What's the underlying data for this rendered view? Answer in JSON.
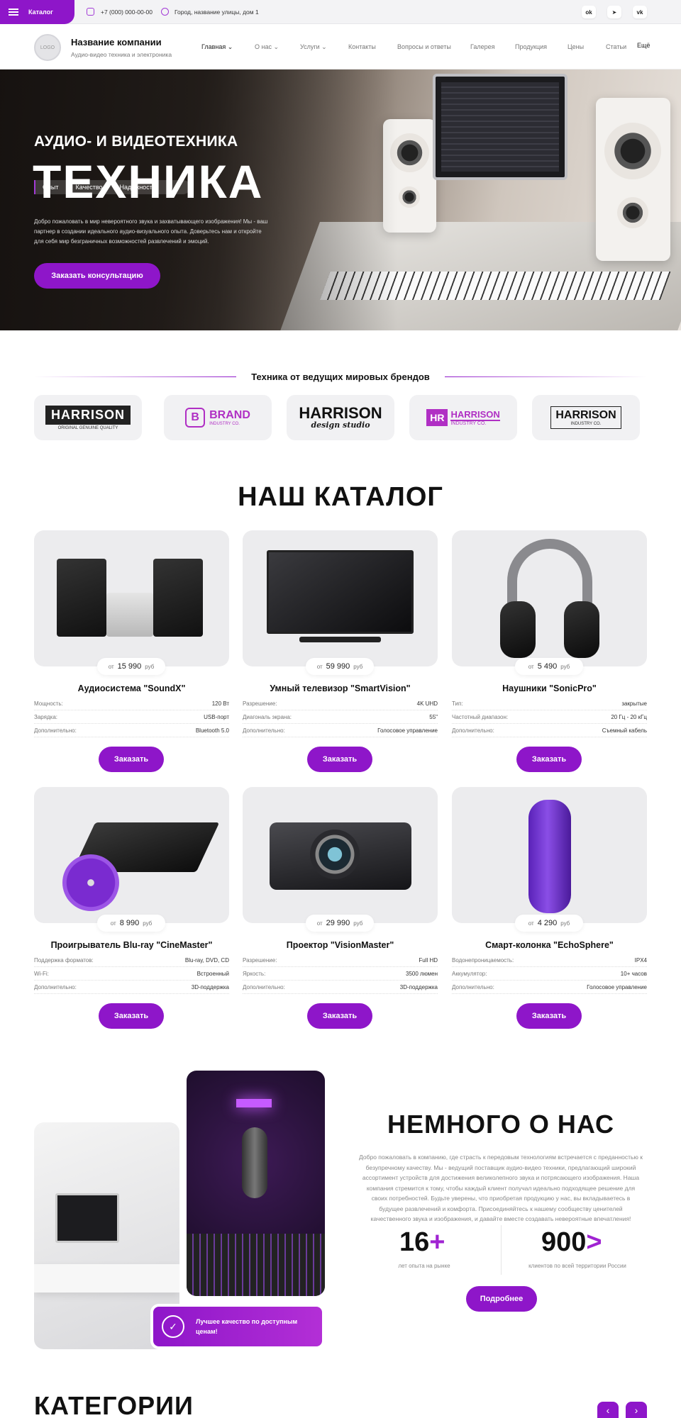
{
  "topbar": {
    "catalog_label": "Каталог",
    "phone": "+7 (000) 000-00-00",
    "address": "Город, название улицы, дом 1",
    "socials": [
      {
        "icon": "ok-icon",
        "label": "ok"
      },
      {
        "icon": "telegram-icon",
        "label": "➤"
      },
      {
        "icon": "vk-icon",
        "label": "vk"
      }
    ]
  },
  "header": {
    "logo_text": "LOGO",
    "company_name": "Название компании",
    "tagline": "Аудио-видео техника и электроника",
    "nav": [
      {
        "label": "Главная ⌄",
        "active": true
      },
      {
        "label": "О нас ⌄",
        "active": false
      },
      {
        "label": "Услуги ⌄",
        "active": false
      },
      {
        "label": "Контакты",
        "active": false
      },
      {
        "label": "Вопросы и ответы",
        "active": false
      },
      {
        "label": "Галерея",
        "active": false
      },
      {
        "label": "Продукция",
        "active": false
      },
      {
        "label": "Цены",
        "active": false
      },
      {
        "label": "Статьи",
        "active": false
      },
      {
        "label": "Ещё",
        "active": true
      }
    ]
  },
  "hero": {
    "badges": [
      "Опыт",
      "Качество",
      "Надежность"
    ],
    "subtitle": "АУДИО- И ВИДЕОТЕХНИКА",
    "title": "ТЕХНИКА",
    "description": "Добро пожаловать в мир невероятного звука и захватывающего изображения! Мы - ваш партнер в создании идеального аудио-визуального опыта. Доверьтесь нам и откройте для себя мир безграничных возможностей развлечений и эмоций.",
    "cta_label": "Заказать консультацию"
  },
  "brands": {
    "title": "Техника от ведущих мировых брендов",
    "items": [
      {
        "name": "HARRISON",
        "sub": "ORIGINAL GENUINE QUALITY"
      },
      {
        "name": "BRAND",
        "sub": "INDUSTRY CO."
      },
      {
        "name": "HARRISON",
        "sub": "design studio"
      },
      {
        "name": "HARRISON",
        "sub": "INDUSTRY CO."
      },
      {
        "name": "HARRISON",
        "sub": "INDUSTRY CO."
      }
    ]
  },
  "catalog": {
    "title": "НАШ КАТАЛОГ",
    "price_prefix": "от",
    "price_suffix": "руб",
    "order_label": "Заказать",
    "products": [
      {
        "name": "Аудиосистема \"SoundX\"",
        "price": "15 990",
        "image": "stereo-system-image",
        "specs": [
          [
            "Мощность:",
            "120 Вт"
          ],
          [
            "Зарядка:",
            "USB-порт"
          ],
          [
            "Дополнительно:",
            "Bluetooth 5.0"
          ]
        ]
      },
      {
        "name": "Умный телевизор \"SmartVision\"",
        "price": "59 990",
        "image": "tv-image",
        "specs": [
          [
            "Разрешение:",
            "4K UHD"
          ],
          [
            "Диагональ экрана:",
            "55\""
          ],
          [
            "Дополнительно:",
            "Голосовое управление"
          ]
        ]
      },
      {
        "name": "Наушники \"SonicPro\"",
        "price": "5 490",
        "image": "headphones-image",
        "specs": [
          [
            "Тип:",
            "закрытые"
          ],
          [
            "Частотный диапазон:",
            "20 Гц - 20 кГц"
          ],
          [
            "Дополнительно:",
            "Съемный кабель"
          ]
        ]
      },
      {
        "name": "Проигрыватель Blu-ray \"CineMaster\"",
        "price": "8 990",
        "image": "bluray-player-image",
        "specs": [
          [
            "Поддержка форматов:",
            "Blu-ray, DVD, CD"
          ],
          [
            "Wi-Fi:",
            "Встроенный"
          ],
          [
            "Дополнительно:",
            "3D-поддержка"
          ]
        ]
      },
      {
        "name": "Проектор \"VisionMaster\"",
        "price": "29 990",
        "image": "projector-image",
        "specs": [
          [
            "Разрешение:",
            "Full HD"
          ],
          [
            "Яркость:",
            "3500 люмен"
          ],
          [
            "Дополнительно:",
            "3D-поддержка"
          ]
        ]
      },
      {
        "name": "Смарт-колонка \"EchoSphere\"",
        "price": "4 290",
        "image": "smart-speaker-image",
        "specs": [
          [
            "Водонепроницаемость:",
            "IPX4"
          ],
          [
            "Аккумулятор:",
            "10+ часов"
          ],
          [
            "Дополнительно:",
            "Голосовое управление"
          ]
        ]
      }
    ]
  },
  "about": {
    "title": "НЕМНОГО О НАС",
    "description": "Добро пожаловать в компанию, где страсть к передовым технологиям встречается с преданностью к безупречному качеству. Мы - ведущий поставщик аудио-видео техники, предлагающий широкий ассортимент устройств для достижения великолепного звука и потрясающего изображения. Наша компания стремится к тому, чтобы каждый клиент получал идеально подходящее решение для своих потребностей. Будьте уверены, что приобретая продукцию у нас, вы вкладываетесь в будущее развлечений и комфорта. Присоединяйтесь к нашему сообществу ценителей качественного звука и изображения, и давайте вместе создавать невероятные впечатления!",
    "quality_text": "Лучшее качество по доступным ценам!",
    "stats": [
      {
        "value": "16",
        "suffix": "+",
        "label": "лет опыта на рынке"
      },
      {
        "value": "900",
        "suffix": ">",
        "label": "клиентов по всей территории России"
      }
    ],
    "more_label": "Подробнее"
  },
  "categories": {
    "title": "КАТЕГОРИИ",
    "prev": "‹",
    "next": "›"
  },
  "colors": {
    "accent": "#8e16c9",
    "accent_light": "#a023d2"
  }
}
